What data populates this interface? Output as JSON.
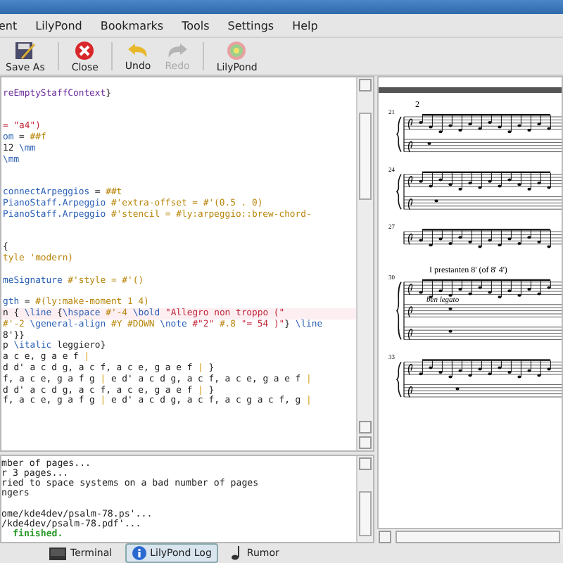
{
  "menu": [
    "ent",
    "LilyPond",
    "Bookmarks",
    "Tools",
    "Settings",
    "Help"
  ],
  "toolbar": [
    {
      "label": "Save As",
      "kind": "saveas",
      "disabled": false
    },
    {
      "label": "Close",
      "kind": "close",
      "disabled": false
    },
    {
      "label": "Undo",
      "kind": "undo",
      "disabled": false
    },
    {
      "label": "Redo",
      "kind": "redo",
      "disabled": true
    },
    {
      "label": "LilyPond",
      "kind": "lilypond",
      "disabled": false
    }
  ],
  "editor": {
    "lines": [
      {
        "kind": "code",
        "highlighted": false,
        "segments": [
          {
            "kind": "purple",
            "text": "reEmptyStaffContext"
          },
          {
            "kind": "plain",
            "text": "}"
          }
        ]
      },
      {
        "kind": "blank"
      },
      {
        "kind": "blank"
      },
      {
        "kind": "code",
        "highlighted": false,
        "segments": [
          {
            "kind": "string",
            "text": "= \"a4\")"
          }
        ]
      },
      {
        "kind": "code",
        "highlighted": false,
        "segments": [
          {
            "kind": "kw",
            "text": "om"
          },
          {
            "kind": "plain",
            "text": " = "
          },
          {
            "kind": "scheme",
            "text": "##f"
          }
        ]
      },
      {
        "kind": "code",
        "highlighted": false,
        "segments": [
          {
            "kind": "plain",
            "text": "12 "
          },
          {
            "kind": "kw",
            "text": "\\mm"
          }
        ]
      },
      {
        "kind": "code",
        "highlighted": false,
        "segments": [
          {
            "kind": "kw",
            "text": "\\mm"
          }
        ]
      },
      {
        "kind": "blank"
      },
      {
        "kind": "blank"
      },
      {
        "kind": "code",
        "highlighted": false,
        "segments": [
          {
            "kind": "kw",
            "text": "connectArpeggios"
          },
          {
            "kind": "plain",
            "text": " = "
          },
          {
            "kind": "scheme",
            "text": "##t"
          }
        ]
      },
      {
        "kind": "code",
        "highlighted": false,
        "segments": [
          {
            "kind": "kw",
            "text": "PianoStaff.Arpeggio"
          },
          {
            "kind": "scheme",
            "text": " #'extra-offset = #'(0.5 . 0)"
          }
        ]
      },
      {
        "kind": "code",
        "highlighted": false,
        "segments": [
          {
            "kind": "kw",
            "text": "PianoStaff.Arpeggio"
          },
          {
            "kind": "scheme",
            "text": " #'stencil = #ly:arpeggio::brew-chord-"
          }
        ]
      },
      {
        "kind": "blank"
      },
      {
        "kind": "blank"
      },
      {
        "kind": "code",
        "highlighted": false,
        "segments": [
          {
            "kind": "plain",
            "text": "{"
          }
        ]
      },
      {
        "kind": "code",
        "highlighted": false,
        "segments": [
          {
            "kind": "scheme",
            "text": "tyle 'modern)"
          }
        ]
      },
      {
        "kind": "blank"
      },
      {
        "kind": "code",
        "highlighted": false,
        "segments": [
          {
            "kind": "kw",
            "text": "meSignature"
          },
          {
            "kind": "scheme",
            "text": " #'style = #'()"
          }
        ]
      },
      {
        "kind": "blank"
      },
      {
        "kind": "code",
        "highlighted": false,
        "segments": [
          {
            "kind": "kw",
            "text": "gth"
          },
          {
            "kind": "plain",
            "text": " = "
          },
          {
            "kind": "scheme",
            "text": "#(ly:make-moment 1 4)"
          }
        ]
      },
      {
        "kind": "code",
        "highlighted": true,
        "segments": [
          {
            "kind": "plain",
            "text": "n { "
          },
          {
            "kind": "kw",
            "text": "\\line"
          },
          {
            "kind": "plain",
            "text": " {"
          },
          {
            "kind": "kw",
            "text": "\\hspace"
          },
          {
            "kind": "scheme",
            "text": " #'-4 "
          },
          {
            "kind": "kw",
            "text": "\\bold"
          },
          {
            "kind": "string",
            "text": " \"Allegro non troppo (\""
          }
        ]
      },
      {
        "kind": "code",
        "highlighted": false,
        "segments": [
          {
            "kind": "scheme",
            "text": "#'-2 "
          },
          {
            "kind": "kw",
            "text": "\\general-align"
          },
          {
            "kind": "scheme",
            "text": " #Y #DOWN "
          },
          {
            "kind": "kw",
            "text": "\\note"
          },
          {
            "kind": "string",
            "text": " #\"2\""
          },
          {
            "kind": "scheme",
            "text": " #.8 "
          },
          {
            "kind": "string",
            "text": "\"= 54 )\""
          },
          {
            "kind": "plain",
            "text": "} "
          },
          {
            "kind": "kw",
            "text": "\\line"
          }
        ]
      },
      {
        "kind": "code",
        "highlighted": false,
        "segments": [
          {
            "kind": "plain",
            "text": "8'}}"
          }
        ]
      },
      {
        "kind": "code",
        "highlighted": false,
        "segments": [
          {
            "kind": "plain",
            "text": "p "
          },
          {
            "kind": "kw",
            "text": "\\italic"
          },
          {
            "kind": "plain",
            "text": " leggiero}"
          }
        ]
      },
      {
        "kind": "code",
        "highlighted": false,
        "segments": [
          {
            "kind": "plain",
            "text": "a c e, g a e f "
          },
          {
            "kind": "bar",
            "text": "|"
          }
        ]
      },
      {
        "kind": "code",
        "highlighted": false,
        "segments": [
          {
            "kind": "plain",
            "text": "d d' a c d g, a c f, a c e, g a e f "
          },
          {
            "kind": "bar",
            "text": "|"
          },
          {
            "kind": "plain",
            "text": " }"
          }
        ]
      },
      {
        "kind": "code",
        "highlighted": false,
        "segments": [
          {
            "kind": "plain",
            "text": "f, a c e, g a f g "
          },
          {
            "kind": "bar",
            "text": "|"
          },
          {
            "kind": "plain",
            "text": " e d' a c d g, a c f, a c e, g a e f "
          },
          {
            "kind": "bar",
            "text": "|"
          }
        ]
      },
      {
        "kind": "code",
        "highlighted": false,
        "segments": [
          {
            "kind": "plain",
            "text": "d d' a c d g, a c f, a c e, g a e f "
          },
          {
            "kind": "bar",
            "text": "|"
          },
          {
            "kind": "plain",
            "text": " }"
          }
        ]
      },
      {
        "kind": "code",
        "highlighted": false,
        "segments": [
          {
            "kind": "plain",
            "text": "f, a c e, g a f g "
          },
          {
            "kind": "bar",
            "text": "|"
          },
          {
            "kind": "plain",
            "text": " e d' a c d g, a c f, a c g a c f, g "
          },
          {
            "kind": "bar",
            "text": "|"
          }
        ]
      }
    ]
  },
  "log": [
    {
      "text": "mber of pages...",
      "kind": "plain"
    },
    {
      "text": "r 3 pages...",
      "kind": "plain"
    },
    {
      "text": "ried to space systems on a bad number of pages",
      "kind": "plain"
    },
    {
      "text": "ngers",
      "kind": "plain"
    },
    {
      "kind": "blank"
    },
    {
      "text": "ome/kde4dev/psalm-78.ps'...",
      "kind": "plain"
    },
    {
      "text": "/kde4dev/psalm-78.pdf'...",
      "kind": "plain"
    },
    {
      "text": "finished.",
      "kind": "success"
    }
  ],
  "bottom_tabs": [
    {
      "label": "Terminal",
      "kind": "terminal",
      "selected": false
    },
    {
      "label": "LilyPond Log",
      "kind": "info",
      "selected": true
    },
    {
      "label": "Rumor",
      "kind": "note",
      "selected": false
    }
  ],
  "score": {
    "page_number": "2",
    "systems": [
      {
        "number": "21",
        "kind": "piano"
      },
      {
        "number": "24",
        "kind": "piano"
      },
      {
        "number": "27",
        "kind": "single"
      },
      {
        "number": "30",
        "kind": "organ",
        "caption": "I prestanten 8' (of 8' 4')",
        "expression": "ben legato"
      },
      {
        "number": "33",
        "kind": "piano"
      }
    ]
  }
}
